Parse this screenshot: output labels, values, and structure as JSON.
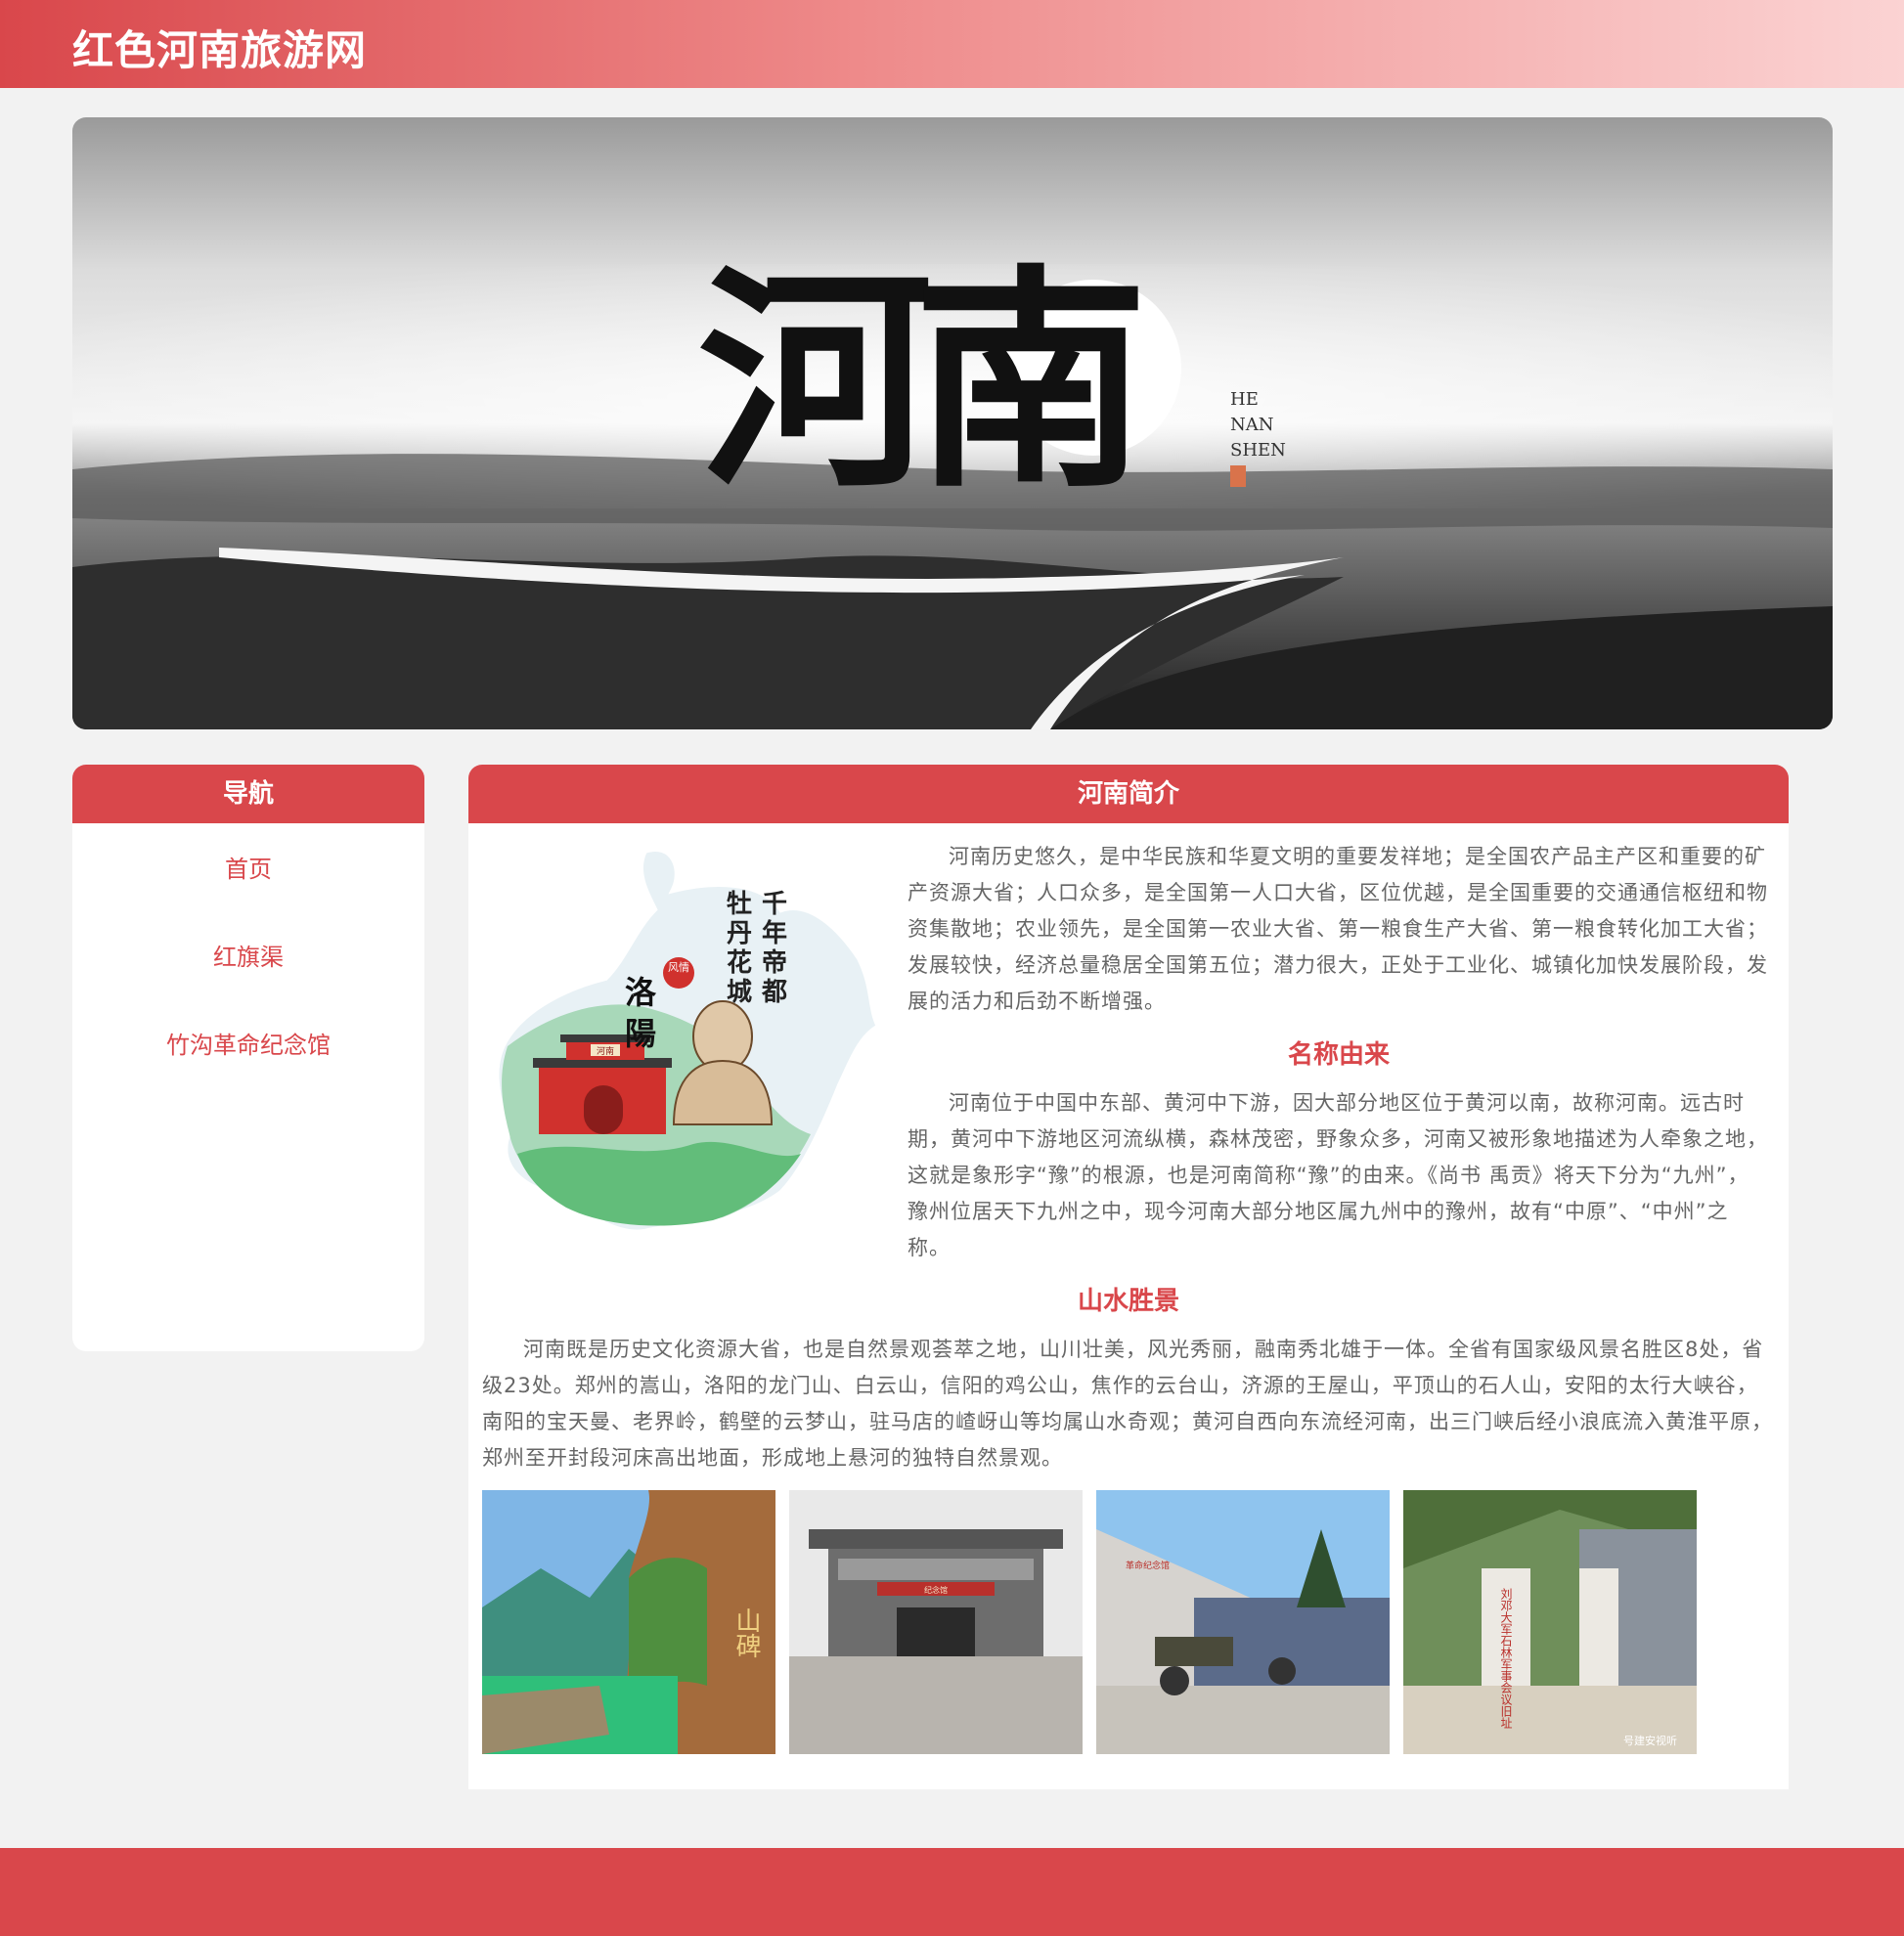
{
  "site": {
    "title": "红色河南旅游网"
  },
  "banner": {
    "calligraphy": "河南",
    "pinyin": [
      "HE",
      "NAN",
      "SHEN"
    ]
  },
  "nav": {
    "title": "导航",
    "items": [
      {
        "label": "首页"
      },
      {
        "label": "红旗渠"
      },
      {
        "label": "竹沟革命纪念馆"
      }
    ]
  },
  "main": {
    "title": "河南简介",
    "map": {
      "line1": "千年帝都",
      "line2": "牡丹花城",
      "city": "洛陽",
      "stamp": "风情",
      "gate_sign": "河南"
    },
    "intro": "河南历史悠久，是中华民族和华夏文明的重要发祥地；是全国农产品主产区和重要的矿产资源大省；人口众多，是全国第一人口大省，区位优越，是全国重要的交通通信枢纽和物资集散地；农业领先，是全国第一农业大省、第一粮食生产大省、第一粮食转化加工大省；发展较快，经济总量稳居全国第五位；潜力很大，正处于工业化、城镇化加快发展阶段，发展的活力和后劲不断增强。",
    "name_origin": {
      "title": "名称由来",
      "text": "河南位于中国中东部、黄河中下游，因大部分地区位于黄河以南，故称河南。远古时期，黄河中下游地区河流纵横，森林茂密，野象众多，河南又被形象地描述为人牵象之地，这就是象形字“豫”的根源，也是河南简称“豫”的由来。《尚书 禹贡》将天下分为“九州”，豫州位居天下九州之中，现今河南大部分地区属九州中的豫州，故有“中原”、“中州”之称。"
    },
    "scenery": {
      "title": "山水胜景",
      "text": "河南既是历史文化资源大省，也是自然景观荟萃之地，山川壮美，风光秀丽，融南秀北雄于一体。全省有国家级风景名胜区8处，省级23处。郑州的嵩山，洛阳的龙门山、白云山，信阳的鸡公山，焦作的云台山，济源的王屋山，平顶山的石人山，安阳的太行大峡谷，南阳的宝天曼、老界岭，鹤壁的云梦山，驻马店的嵖岈山等均属山水奇观；黄河自西向东流经河南，出三门峡后经小浪底流入黄淮平原，郑州至开封段河床高出地面，形成地上悬河的独特自然景观。"
    },
    "photos": [
      {
        "caption": "山碑"
      },
      {
        "caption": "纪念馆"
      },
      {
        "caption": "革命纪念馆"
      },
      {
        "caption": "刘邓大军石林军事会议旧址",
        "watermark": "号建安视听"
      }
    ]
  },
  "colors": {
    "accent": "#d9474b",
    "background": "#f2f2f2"
  }
}
